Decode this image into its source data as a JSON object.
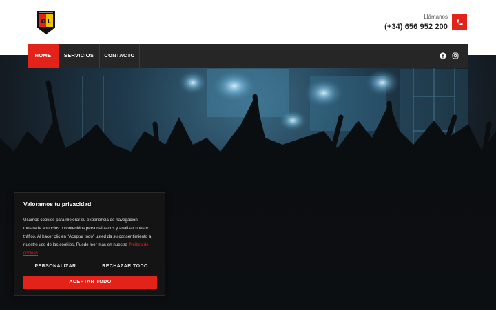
{
  "header": {
    "logo_name": "DL shield logo",
    "phone_caption": "Llámanos",
    "phone_number": "(+34) 656 952 200",
    "phone_icon": "phone-icon"
  },
  "nav": {
    "items": [
      {
        "label": "HOME",
        "active": true
      },
      {
        "label": "SERVICIOS",
        "active": false
      },
      {
        "label": "CONTACTO",
        "active": false
      }
    ],
    "social_icons": [
      "facebook-icon",
      "instagram-icon"
    ]
  },
  "hero": {
    "scene": "concert crowd silhouettes with stage lights"
  },
  "cookie": {
    "title": "Valoramos tu privacidad",
    "body": "Usamos cookies para mejorar su experiencia de navegación, mostrarle anuncios o contenidos personalizados y analizar nuestro tráfico. Al hacer clic en \"Aceptar todo\" usted da su consentimiento a nuestro uso de las cookies. Puede leer más en nuestra",
    "link_label": "Política de cookies",
    "customize_label": "PERSONALIZAR",
    "reject_label": "RECHAZAR TODO",
    "accept_label": "ACEPTAR TODO"
  },
  "colors": {
    "accent": "#e3221a",
    "nav_bg": "#262626",
    "modal_bg": "#141414"
  }
}
